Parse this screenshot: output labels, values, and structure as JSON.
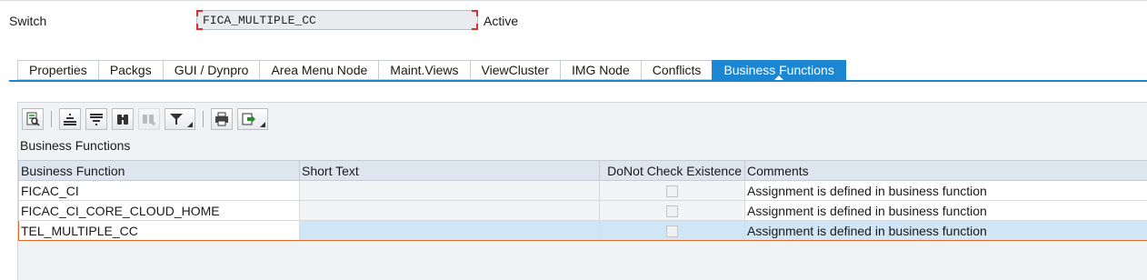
{
  "header": {
    "switch_label": "Switch",
    "switch_value": "FICA_MULTIPLE_CC",
    "status": "Active"
  },
  "tabs": [
    {
      "label": "Properties",
      "active": false
    },
    {
      "label": "Packgs",
      "active": false
    },
    {
      "label": "GUI / Dynpro",
      "active": false
    },
    {
      "label": "Area Menu Node",
      "active": false
    },
    {
      "label": "Maint.Views",
      "active": false
    },
    {
      "label": "ViewCluster",
      "active": false
    },
    {
      "label": "IMG Node",
      "active": false
    },
    {
      "label": "Conflicts",
      "active": false
    },
    {
      "label": "Business Functions",
      "active": true
    }
  ],
  "toolbar": {
    "icons": [
      "details-icon",
      "align-top-icon",
      "align-bottom-icon",
      "find-icon",
      "find-next-icon",
      "filter-icon",
      "print-icon",
      "export-icon"
    ]
  },
  "section_title": "Business Functions",
  "table": {
    "columns": [
      "Business Function",
      "Short Text",
      "DoNot Check Existence",
      "Comments"
    ],
    "rows": [
      {
        "business_function": "FICAC_CI",
        "short_text": "",
        "donot_check": false,
        "comments": "Assignment is defined in business function"
      },
      {
        "business_function": "FICAC_CI_CORE_CLOUD_HOME",
        "short_text": "",
        "donot_check": false,
        "comments": "Assignment is defined in business function"
      },
      {
        "business_function": "TEL_MULTIPLE_CC",
        "short_text": "",
        "donot_check": false,
        "comments": "Assignment is defined in business function",
        "selected": true
      }
    ]
  },
  "colors": {
    "accent": "#1d86d2",
    "selection": "#d0e5f5",
    "focus_border": "#e06a2c",
    "required_corner": "#d9302b"
  }
}
